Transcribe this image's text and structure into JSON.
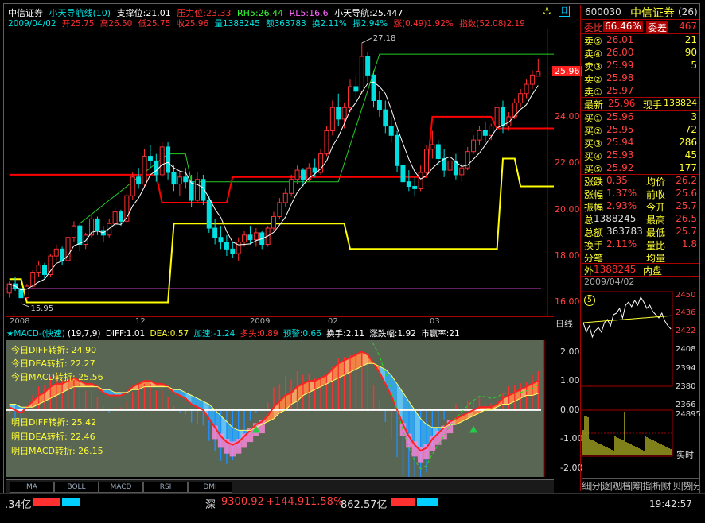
{
  "header": {
    "stock_name": "中信证券",
    "indicator": "小天导航线(10)",
    "support_label": "支撑位:",
    "support_value": "21.01",
    "resistance_label": "压力位:",
    "resistance_value": "23.33",
    "rh5_label": "RH5:",
    "rh5_value": "26.44",
    "rl5_label": "RL5:",
    "rl5_value": "16.6",
    "nav_label": "小天导航:",
    "nav_value": "25.447",
    "date": "2009/04/02",
    "open": "开25.75",
    "high": "高26.50",
    "low": "低25.75",
    "close": "收25.96",
    "volume": "量1388245",
    "amount": "额363783",
    "turnover": "换2.11%",
    "amplitude": "振2.94%",
    "change": "涨(0.49)1.92%",
    "index": "指数(52.08)2.19"
  },
  "main_chart": {
    "price_axis": [
      "24.00",
      "22.00",
      "20.00",
      "18.00",
      "16.00"
    ],
    "current_price_tag": "25.96",
    "high_marker": "27.18",
    "low_marker": "15.95",
    "date_labels": [
      "2008",
      "12",
      "2009",
      "02",
      "03"
    ],
    "period_label": "日线",
    "candles": [
      [
        16.4,
        16.9,
        16.2,
        16.8
      ],
      [
        16.8,
        17.1,
        16.5,
        16.6
      ],
      [
        16.6,
        16.7,
        15.95,
        16.2
      ],
      [
        16.2,
        16.8,
        16.1,
        16.7
      ],
      [
        16.7,
        17.4,
        16.6,
        17.3
      ],
      [
        17.3,
        17.8,
        17.1,
        17.6
      ],
      [
        17.6,
        17.7,
        17.0,
        17.2
      ],
      [
        17.2,
        18.1,
        17.1,
        18.0
      ],
      [
        18.0,
        18.5,
        17.8,
        18.3
      ],
      [
        18.3,
        18.4,
        17.6,
        17.8
      ],
      [
        17.8,
        18.9,
        17.7,
        18.8
      ],
      [
        18.8,
        19.5,
        18.6,
        19.3
      ],
      [
        19.3,
        19.4,
        18.2,
        18.5
      ],
      [
        18.5,
        19.0,
        18.3,
        18.9
      ],
      [
        18.9,
        19.8,
        18.8,
        19.6
      ],
      [
        19.6,
        19.7,
        18.9,
        19.1
      ],
      [
        19.1,
        19.3,
        18.6,
        18.9
      ],
      [
        18.9,
        19.6,
        18.8,
        19.4
      ],
      [
        19.4,
        20.1,
        19.2,
        19.9
      ],
      [
        19.9,
        20.0,
        19.3,
        19.5
      ],
      [
        19.5,
        20.8,
        19.4,
        20.6
      ],
      [
        20.6,
        21.6,
        20.4,
        21.4
      ],
      [
        21.4,
        21.8,
        20.9,
        21.1
      ],
      [
        21.1,
        22.6,
        21.0,
        22.3
      ],
      [
        22.3,
        22.8,
        21.8,
        22.1
      ],
      [
        22.1,
        22.4,
        21.2,
        21.5
      ],
      [
        21.5,
        22.9,
        21.4,
        22.7
      ],
      [
        22.7,
        22.9,
        21.3,
        21.6
      ],
      [
        21.6,
        21.9,
        20.8,
        21.1
      ],
      [
        21.1,
        21.6,
        20.6,
        21.4
      ],
      [
        21.4,
        21.8,
        20.9,
        21.2
      ],
      [
        21.2,
        21.5,
        20.1,
        20.4
      ],
      [
        20.4,
        21.6,
        20.3,
        21.3
      ],
      [
        21.3,
        21.5,
        20.2,
        20.4
      ],
      [
        20.4,
        20.6,
        19.0,
        19.2
      ],
      [
        19.2,
        19.6,
        18.5,
        18.8
      ],
      [
        18.8,
        19.3,
        18.3,
        18.6
      ],
      [
        18.6,
        18.9,
        18.0,
        18.3
      ],
      [
        18.3,
        18.6,
        17.9,
        18.1
      ],
      [
        18.1,
        18.8,
        17.8,
        18.6
      ],
      [
        18.6,
        19.1,
        18.4,
        18.9
      ],
      [
        18.9,
        19.3,
        18.5,
        18.7
      ],
      [
        18.7,
        19.2,
        18.4,
        19.0
      ],
      [
        19.0,
        19.1,
        18.3,
        18.5
      ],
      [
        18.5,
        19.3,
        18.4,
        19.2
      ],
      [
        19.2,
        19.9,
        19.1,
        19.7
      ],
      [
        19.7,
        20.5,
        19.6,
        20.3
      ],
      [
        20.3,
        20.9,
        20.1,
        20.7
      ],
      [
        20.7,
        21.5,
        20.6,
        21.3
      ],
      [
        21.3,
        21.9,
        21.1,
        21.7
      ],
      [
        21.7,
        21.8,
        21.0,
        21.3
      ],
      [
        21.3,
        22.0,
        21.2,
        21.8
      ],
      [
        21.8,
        22.2,
        21.4,
        21.6
      ],
      [
        21.6,
        22.6,
        21.5,
        22.4
      ],
      [
        22.4,
        23.6,
        22.3,
        23.4
      ],
      [
        23.4,
        24.7,
        23.2,
        24.4
      ],
      [
        24.4,
        25.0,
        23.6,
        23.9
      ],
      [
        23.9,
        24.6,
        23.5,
        24.4
      ],
      [
        24.4,
        25.6,
        24.2,
        25.3
      ],
      [
        25.3,
        25.8,
        24.8,
        25.1
      ],
      [
        25.1,
        27.18,
        25.0,
        26.6
      ],
      [
        26.6,
        26.8,
        25.5,
        25.8
      ],
      [
        25.8,
        26.0,
        24.4,
        24.7
      ],
      [
        24.7,
        25.1,
        24.0,
        24.3
      ],
      [
        24.3,
        24.7,
        23.3,
        23.6
      ],
      [
        23.6,
        24.0,
        22.9,
        23.2
      ],
      [
        23.2,
        23.4,
        21.6,
        21.9
      ],
      [
        21.9,
        22.3,
        20.9,
        21.2
      ],
      [
        21.2,
        21.7,
        20.8,
        21.0
      ],
      [
        21.0,
        21.4,
        20.6,
        20.9
      ],
      [
        20.9,
        21.9,
        20.8,
        21.6
      ],
      [
        21.6,
        22.8,
        21.5,
        22.6
      ],
      [
        22.6,
        23.4,
        22.2,
        22.8
      ],
      [
        22.8,
        23.0,
        21.9,
        22.2
      ],
      [
        22.2,
        22.6,
        21.4,
        21.7
      ],
      [
        21.7,
        22.3,
        21.5,
        22.1
      ],
      [
        22.1,
        22.4,
        21.3,
        21.5
      ],
      [
        21.5,
        22.0,
        21.2,
        21.8
      ],
      [
        21.8,
        22.7,
        21.7,
        22.5
      ],
      [
        22.5,
        23.2,
        22.4,
        23.0
      ],
      [
        23.0,
        23.6,
        22.8,
        23.4
      ],
      [
        23.4,
        23.8,
        22.9,
        23.2
      ],
      [
        23.2,
        23.7,
        23.0,
        23.6
      ],
      [
        23.6,
        24.6,
        23.5,
        24.4
      ],
      [
        24.4,
        24.7,
        23.3,
        23.6
      ],
      [
        23.6,
        24.2,
        23.4,
        24.0
      ],
      [
        24.0,
        24.8,
        23.9,
        24.6
      ],
      [
        24.6,
        25.2,
        24.4,
        25.0
      ],
      [
        25.0,
        25.6,
        24.8,
        25.4
      ],
      [
        25.4,
        26.0,
        25.2,
        25.8
      ],
      [
        25.75,
        26.5,
        25.75,
        25.96
      ]
    ],
    "support_line": [
      [
        0,
        17.0
      ],
      [
        2,
        17.0
      ],
      [
        3,
        16.0
      ],
      [
        27,
        16.0
      ],
      [
        28,
        19.4
      ],
      [
        57,
        19.4
      ],
      [
        58,
        18.3
      ],
      [
        83,
        18.3
      ],
      [
        84,
        22.2
      ],
      [
        86,
        22.2
      ],
      [
        87,
        21.0
      ],
      [
        95,
        21.0
      ]
    ],
    "resistance_line": [
      [
        0,
        21.5
      ],
      [
        25,
        21.5
      ],
      [
        26,
        20.3
      ],
      [
        37,
        20.3
      ],
      [
        38,
        21.4
      ],
      [
        71,
        21.4
      ],
      [
        72,
        24.0
      ],
      [
        82,
        24.0
      ],
      [
        83,
        23.5
      ],
      [
        95,
        23.5
      ]
    ],
    "green_line": [
      [
        12,
        19.4
      ],
      [
        27,
        22.4
      ],
      [
        30,
        22.4
      ],
      [
        31,
        21.2
      ],
      [
        56,
        21.2
      ],
      [
        63,
        26.7
      ],
      [
        95,
        26.7
      ]
    ],
    "magenta_level": 16.6
  },
  "macd": {
    "title": "MACD-(快速)",
    "params": "(19,7,9)",
    "diff_label": "DIFF:",
    "diff_value": "1.01",
    "dea_label": "DEA:",
    "dea_value": "0.57",
    "accel_label": "加速:",
    "accel_value": "-1.24",
    "bull_label": "多头:",
    "bull_value": "0.89",
    "warn_label": "预警:",
    "warn_value": "0.66",
    "turnover_label": "换手:",
    "turnover_value": "2.11",
    "change_amp_label": "涨跌幅:",
    "change_amp_value": "1.92",
    "pe_label": "市赢率:",
    "pe_value": "21",
    "axis": [
      "2.00",
      "1.00",
      "0.00",
      "-1.00",
      "-2.00"
    ],
    "today_diff": "今日DIFF转折: 24.90",
    "today_dea": "今日DEA转折: 22.27",
    "today_macd": "今日MACD转折: 25.56",
    "tomorrow_diff": "明日DIFF转折: 25.42",
    "tomorrow_dea": "明日DEA转折: 22.46",
    "tomorrow_macd": "明日MACD转折: 26.15",
    "diff_series": [
      0.1,
      0.0,
      -0.1,
      0.1,
      0.3,
      0.5,
      0.6,
      0.8,
      0.9,
      0.9,
      1.0,
      1.1,
      1.0,
      0.9,
      0.9,
      0.8,
      0.6,
      0.5,
      0.5,
      0.5,
      0.6,
      0.8,
      0.9,
      1.0,
      1.0,
      0.9,
      0.9,
      0.8,
      0.6,
      0.5,
      0.4,
      0.2,
      0.1,
      0.0,
      -0.3,
      -0.6,
      -0.9,
      -1.1,
      -1.2,
      -1.1,
      -0.9,
      -0.7,
      -0.5,
      -0.4,
      -0.2,
      0.1,
      0.3,
      0.5,
      0.6,
      0.8,
      0.9,
      1.0,
      1.0,
      1.1,
      1.2,
      1.4,
      1.6,
      1.7,
      1.8,
      1.9,
      2.0,
      1.9,
      1.6,
      1.3,
      0.9,
      0.5,
      0.0,
      -0.5,
      -0.9,
      -1.2,
      -1.4,
      -1.3,
      -1.0,
      -0.8,
      -0.6,
      -0.4,
      -0.3,
      -0.2,
      -0.1,
      0.0,
      0.1,
      0.1,
      0.1,
      0.2,
      0.4,
      0.5,
      0.6,
      0.7,
      0.8,
      0.9,
      1.01
    ],
    "dea_series": [
      0.2,
      0.2,
      0.1,
      0.1,
      0.1,
      0.2,
      0.3,
      0.4,
      0.5,
      0.6,
      0.7,
      0.8,
      0.8,
      0.8,
      0.8,
      0.8,
      0.7,
      0.7,
      0.6,
      0.6,
      0.6,
      0.7,
      0.7,
      0.8,
      0.8,
      0.8,
      0.8,
      0.8,
      0.7,
      0.7,
      0.6,
      0.5,
      0.4,
      0.3,
      0.2,
      0.0,
      -0.2,
      -0.4,
      -0.6,
      -0.7,
      -0.7,
      -0.7,
      -0.6,
      -0.5,
      -0.4,
      -0.3,
      -0.1,
      0.0,
      0.2,
      0.3,
      0.5,
      0.6,
      0.7,
      0.8,
      0.9,
      1.0,
      1.1,
      1.2,
      1.3,
      1.4,
      1.5,
      1.6,
      1.6,
      1.5,
      1.4,
      1.2,
      0.9,
      0.6,
      0.3,
      0.0,
      -0.3,
      -0.5,
      -0.6,
      -0.6,
      -0.6,
      -0.5,
      -0.5,
      -0.4,
      -0.3,
      -0.2,
      -0.1,
      0.0,
      0.0,
      0.1,
      0.2,
      0.2,
      0.3,
      0.4,
      0.5,
      0.5,
      0.57
    ],
    "triangles": [
      42,
      79
    ]
  },
  "tabs": [
    "MA",
    "BOLL",
    "MACD",
    "RSI",
    "DMI"
  ],
  "right_panel": {
    "code": "600030",
    "name": "中信证券",
    "page": "(26)",
    "weibi_label": "委比",
    "weibi_value": "66.46%",
    "weicha_label": "委差",
    "weicha_value": "467",
    "sells": [
      {
        "label": "卖⑤",
        "price": "26.01",
        "vol": "21"
      },
      {
        "label": "卖④",
        "price": "26.00",
        "vol": "90"
      },
      {
        "label": "卖③",
        "price": "25.99",
        "vol": "5"
      },
      {
        "label": "卖②",
        "price": "25.98",
        "vol": ""
      },
      {
        "label": "卖①",
        "price": "25.97",
        "vol": ""
      }
    ],
    "latest_label": "最新",
    "latest_value": "25.96",
    "nowhand_label": "现手",
    "nowhand_value": "138824",
    "buys": [
      {
        "label": "买①",
        "price": "25.96",
        "vol": "3"
      },
      {
        "label": "买②",
        "price": "25.95",
        "vol": "72"
      },
      {
        "label": "买③",
        "price": "25.94",
        "vol": "286"
      },
      {
        "label": "买④",
        "price": "25.93",
        "vol": "45"
      },
      {
        "label": "买⑤",
        "price": "25.92",
        "vol": "177"
      }
    ],
    "stats": [
      {
        "k": "涨跌",
        "v": "0.35",
        "k2": "均价",
        "v2": "26.2"
      },
      {
        "k": "涨幅",
        "v": "1.37%",
        "k2": "前收",
        "v2": "25.6"
      },
      {
        "k": "振幅",
        "v": "2.93%",
        "k2": "今开",
        "v2": "25.7"
      },
      {
        "k": "总",
        "v": "1388245",
        "k2": "最高",
        "v2": "26.5"
      },
      {
        "k": "总额",
        "v": "363783",
        "k2": "最低",
        "v2": "25.7"
      },
      {
        "k": "换手",
        "v": "2.11%",
        "k2": "量比",
        "v2": "1.8"
      },
      {
        "k": "分笔",
        "v": "",
        "k2": "均量",
        "v2": ""
      }
    ],
    "outer_label": "外",
    "outer_value": "1388245",
    "inner_label": "内盘",
    "mini_date": "2009/04/02",
    "mini_badge": "5",
    "mini_price_axis": [
      "2450",
      "2436",
      "2422",
      "2408",
      "2394",
      "2380",
      "2366"
    ],
    "mini_vol_axis": [
      "24895"
    ],
    "realtime_label": "实时",
    "bottom_tabs": "细|分|逐|观|档|筹|指|析|财|贝|势|分"
  },
  "status_bar": {
    "left_value": ".34亿",
    "index_name": "深",
    "index_value": "9300.92",
    "index_change": "+144.91",
    "index_pct": "1.58%",
    "index_amount": "862.57亿",
    "time": "19:42:57"
  },
  "colors": {
    "up": "#ff3030",
    "down": "#00e0e0",
    "support": "#ffff00",
    "resistance": "#ff0000",
    "green": "#22cc22",
    "panel_bg_indicator": "#5a6654"
  }
}
